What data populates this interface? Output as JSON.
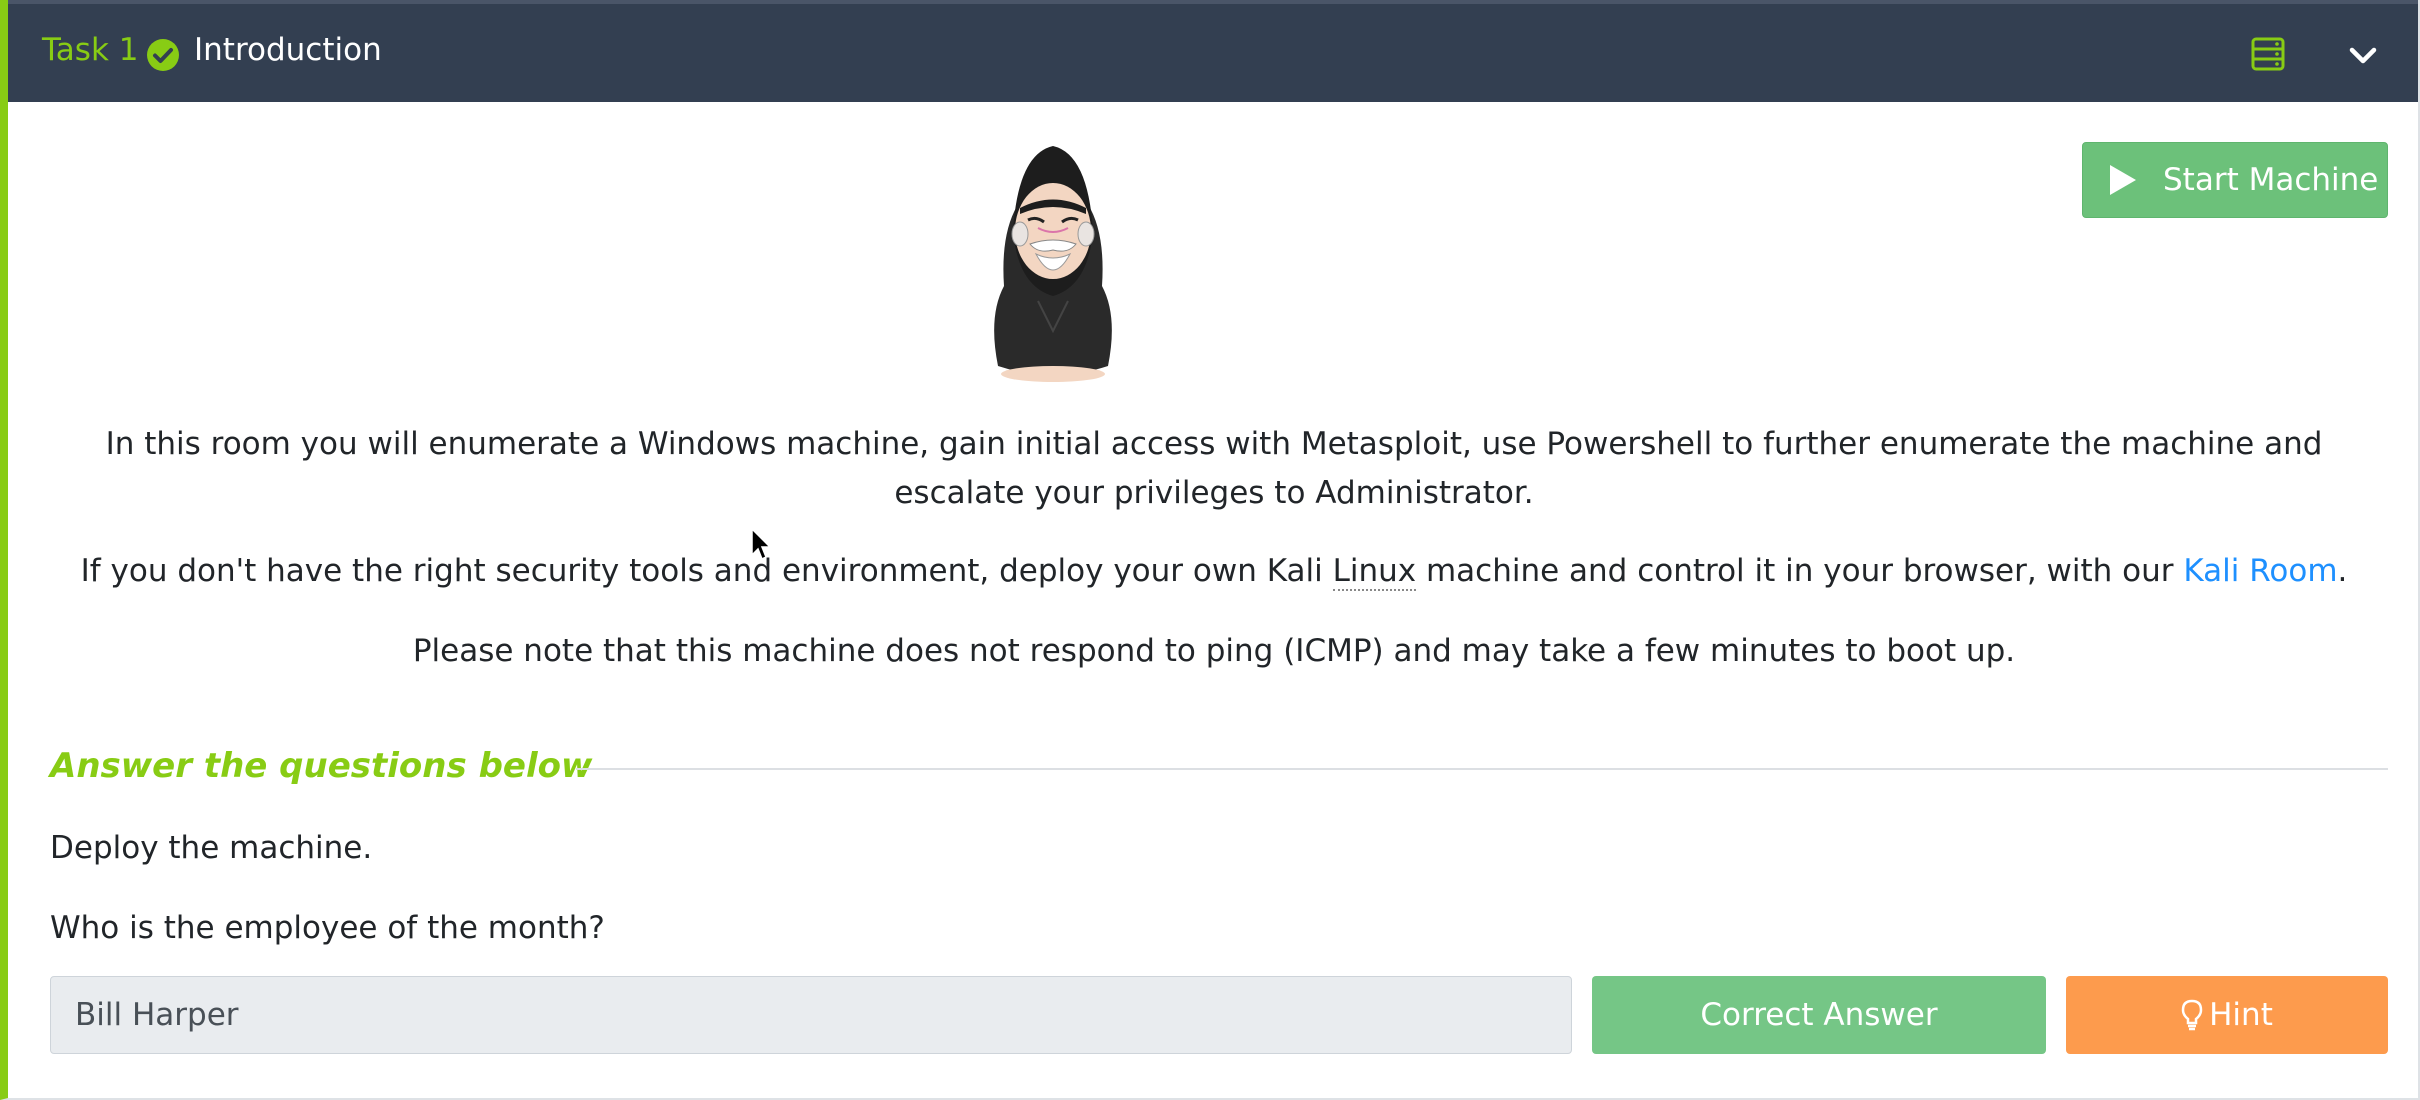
{
  "header": {
    "task_label": "Task 1",
    "title": "Introduction",
    "status_icon": "check-circle-icon",
    "right_icons": [
      "server-icon",
      "chevron-down-icon"
    ]
  },
  "toolbar": {
    "start_machine_label": "Start Machine"
  },
  "content": {
    "intro_paragraph": "In this room you will enumerate a Windows machine, gain initial access with Metasploit, use Powershell to further enumerate the machine and escalate your privileges to Administrator.",
    "tools_before": "If you don't have the right security tools and environment, deploy your own Kali ",
    "tools_abbr": "Linux",
    "tools_middle": " machine and control it in your browser, with our ",
    "tools_link": "Kali Room",
    "tools_after": ".",
    "note_paragraph": "Please note that this machine does not respond to ping (ICMP) and may take a few minutes to boot up."
  },
  "questions": {
    "heading": "Answer the questions below",
    "q1": "Deploy the machine.",
    "q2": "Who is the employee of the month?",
    "q2_answer": "Bill Harper",
    "correct_label": "Correct Answer",
    "hint_label": "Hint"
  },
  "colors": {
    "accent": "#88cc14",
    "header_bg": "#333f51",
    "start_button": "#6cc17a",
    "correct_button": "#75c686",
    "hint_button": "#fd9b4d",
    "link": "#1e90ff"
  }
}
